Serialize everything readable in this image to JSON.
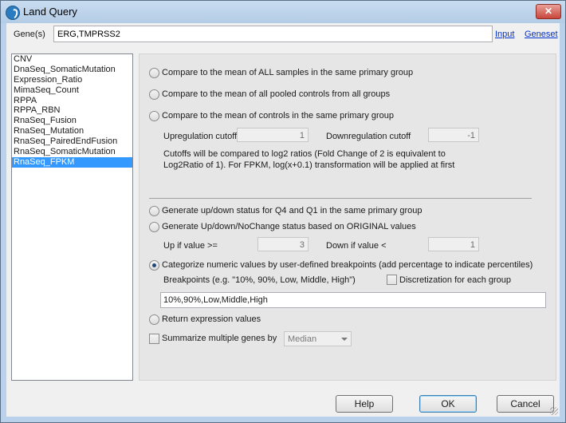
{
  "window": {
    "title": "Land Query",
    "close_label": "✕"
  },
  "genes": {
    "label": "Gene(s)",
    "value": "ERG,TMPRSS2",
    "input_link": "Input",
    "geneset_link": "Geneset"
  },
  "datasets": {
    "items": [
      "CNV",
      "DnaSeq_SomaticMutation",
      "Expression_Ratio",
      "MimaSeq_Count",
      "RPPA",
      "RPPA_RBN",
      "RnaSeq_Fusion",
      "RnaSeq_Mutation",
      "RnaSeq_PairedEndFusion",
      "RnaSeq_SomaticMutation",
      "RnaSeq_FPKM"
    ],
    "selected": "RnaSeq_FPKM"
  },
  "options": {
    "all_samples": "Compare to the mean of ALL samples in the same primary group",
    "pooled_controls": "Compare to the mean of all pooled controls from all groups",
    "controls_group": "Compare to the mean of controls in the same primary group",
    "up_cutoff_label": "Upregulation cutoff",
    "up_cutoff_value": "1",
    "down_cutoff_label": "Downregulation cutoff",
    "down_cutoff_value": "-1",
    "cutoff_note_1": "Cutoffs will be compared to log2 ratios (Fold Change of 2 is equivalent to",
    "cutoff_note_2": "Log2Ratio of 1). For FPKM, log(x+0.1) transformation will be applied at first",
    "q4_q1": "Generate up/down status for Q4 and Q1 in the same primary group",
    "original_values": "Generate Up/down/NoChange status based on ORIGINAL values",
    "up_if_label": "Up if value >=",
    "up_if_value": "3",
    "down_if_label": "Down if value <",
    "down_if_value": "1",
    "categorize": "Categorize numeric values by user-defined breakpoints (add percentage to indicate percentiles)",
    "breakpoints_label": "Breakpoints (e.g. \"10%, 90%, Low, Middle, High\")",
    "discretization_label": "Discretization for each group",
    "breakpoints_value": "10%,90%,Low,Middle,High",
    "return_expression": "Return expression values",
    "summarize_label": "Summarize multiple genes by",
    "summarize_value": "Median",
    "selected_option": "categorize"
  },
  "buttons": {
    "help": "Help",
    "ok": "OK",
    "cancel": "Cancel"
  }
}
